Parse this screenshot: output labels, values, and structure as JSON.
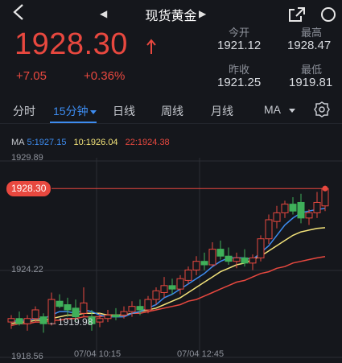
{
  "nav": {
    "title": "现货黄金",
    "back_icon": "back-arrow-icon",
    "share_icon": "share-icon",
    "search_icon": "search-icon"
  },
  "quote": {
    "price": "1928.30",
    "change": "+7.05",
    "change_pct": "+0.36%",
    "color_up": "#e8483f"
  },
  "stats": {
    "open_label": "今开",
    "open": "1921.12",
    "high_label": "最高",
    "high": "1928.47",
    "prev_close_label": "昨收",
    "prev_close": "1921.25",
    "low_label": "最低",
    "low": "1919.81"
  },
  "tabs": {
    "items": [
      "分时",
      "15分钟",
      "日线",
      "周线",
      "月线",
      "MA"
    ],
    "active": "15分钟",
    "active_color": "#3d8cf0"
  },
  "ma_legend": {
    "title": "MA",
    "ma5": "5:1927.15",
    "ma10": "10:1926.04",
    "ma22": "22:1924.38",
    "colors": {
      "ma5": "#3d8cf0",
      "ma10": "#f3e37a",
      "ma22": "#e8483f"
    }
  },
  "chart_axis": {
    "y_top": "1929.89",
    "y_mid": "1924.22",
    "y_bottom": "1918.56",
    "x_label_1": "07/04 10:15",
    "x_label_2": "07/04 12:45",
    "current_tag": "1928.30",
    "low_marker": "←1919.98"
  },
  "chart_data": {
    "type": "candlestick",
    "ylim": [
      1918.56,
      1929.89
    ],
    "candles": [
      {
        "o": 1920.6,
        "h": 1921.0,
        "l": 1920.2,
        "c": 1920.8
      },
      {
        "o": 1920.8,
        "h": 1921.2,
        "l": 1920.4,
        "c": 1920.5
      },
      {
        "o": 1920.5,
        "h": 1921.0,
        "l": 1920.1,
        "c": 1920.8
      },
      {
        "o": 1920.8,
        "h": 1921.5,
        "l": 1920.6,
        "c": 1921.3
      },
      {
        "o": 1920.9,
        "h": 1921.1,
        "l": 1919.98,
        "c": 1920.5
      },
      {
        "o": 1920.5,
        "h": 1922.3,
        "l": 1920.4,
        "c": 1921.9
      },
      {
        "o": 1921.8,
        "h": 1922.2,
        "l": 1921.4,
        "c": 1921.5
      },
      {
        "o": 1921.6,
        "h": 1922.0,
        "l": 1920.9,
        "c": 1921.3
      },
      {
        "o": 1921.4,
        "h": 1921.9,
        "l": 1920.6,
        "c": 1920.9
      },
      {
        "o": 1921.1,
        "h": 1922.6,
        "l": 1920.9,
        "c": 1921.7
      },
      {
        "o": 1920.9,
        "h": 1921.3,
        "l": 1920.1,
        "c": 1920.5
      },
      {
        "o": 1920.6,
        "h": 1921.1,
        "l": 1920.3,
        "c": 1920.8
      },
      {
        "o": 1920.8,
        "h": 1921.3,
        "l": 1920.6,
        "c": 1921.0
      },
      {
        "o": 1921.0,
        "h": 1921.4,
        "l": 1920.7,
        "c": 1920.9
      },
      {
        "o": 1921.0,
        "h": 1921.5,
        "l": 1920.8,
        "c": 1921.2
      },
      {
        "o": 1921.2,
        "h": 1921.8,
        "l": 1920.9,
        "c": 1921.5
      },
      {
        "o": 1921.5,
        "h": 1921.9,
        "l": 1921.0,
        "c": 1921.3
      },
      {
        "o": 1921.3,
        "h": 1922.1,
        "l": 1921.1,
        "c": 1921.9
      },
      {
        "o": 1921.9,
        "h": 1922.6,
        "l": 1921.6,
        "c": 1922.4
      },
      {
        "o": 1922.3,
        "h": 1923.2,
        "l": 1922.0,
        "c": 1922.7
      },
      {
        "o": 1922.7,
        "h": 1923.1,
        "l": 1922.2,
        "c": 1922.5
      },
      {
        "o": 1922.5,
        "h": 1923.3,
        "l": 1922.2,
        "c": 1923.1
      },
      {
        "o": 1923.0,
        "h": 1923.8,
        "l": 1922.8,
        "c": 1923.6
      },
      {
        "o": 1923.6,
        "h": 1924.4,
        "l": 1923.3,
        "c": 1924.1
      },
      {
        "o": 1924.1,
        "h": 1924.6,
        "l": 1923.6,
        "c": 1923.9
      },
      {
        "o": 1923.9,
        "h": 1925.2,
        "l": 1923.8,
        "c": 1924.8
      },
      {
        "o": 1924.8,
        "h": 1925.3,
        "l": 1924.2,
        "c": 1924.4
      },
      {
        "o": 1924.4,
        "h": 1924.9,
        "l": 1923.9,
        "c": 1924.1
      },
      {
        "o": 1924.1,
        "h": 1924.6,
        "l": 1923.7,
        "c": 1924.3
      },
      {
        "o": 1924.3,
        "h": 1924.8,
        "l": 1923.8,
        "c": 1924.0
      },
      {
        "o": 1924.0,
        "h": 1924.5,
        "l": 1923.6,
        "c": 1924.3
      },
      {
        "o": 1924.3,
        "h": 1925.6,
        "l": 1924.1,
        "c": 1925.4
      },
      {
        "o": 1925.4,
        "h": 1926.8,
        "l": 1925.1,
        "c": 1926.5
      },
      {
        "o": 1926.4,
        "h": 1927.3,
        "l": 1926.0,
        "c": 1926.9
      },
      {
        "o": 1926.9,
        "h": 1927.6,
        "l": 1926.6,
        "c": 1927.4
      },
      {
        "o": 1927.4,
        "h": 1927.8,
        "l": 1926.8,
        "c": 1927.0
      },
      {
        "o": 1927.5,
        "h": 1928.0,
        "l": 1926.3,
        "c": 1926.6
      },
      {
        "o": 1926.6,
        "h": 1927.1,
        "l": 1926.2,
        "c": 1926.9
      },
      {
        "o": 1926.9,
        "h": 1928.1,
        "l": 1926.6,
        "c": 1927.5
      },
      {
        "o": 1927.3,
        "h": 1928.47,
        "l": 1927.0,
        "c": 1928.3
      }
    ],
    "ma5": [
      1920.6,
      1920.7,
      1920.7,
      1920.8,
      1920.8,
      1921.0,
      1921.2,
      1921.2,
      1921.1,
      1921.3,
      1921.2,
      1921.0,
      1920.9,
      1920.9,
      1920.9,
      1921.1,
      1921.2,
      1921.4,
      1921.6,
      1922.0,
      1922.2,
      1922.5,
      1922.8,
      1923.1,
      1923.4,
      1923.8,
      1924.1,
      1924.3,
      1924.3,
      1924.3,
      1924.2,
      1924.6,
      1925.0,
      1925.6,
      1926.2,
      1926.6,
      1926.9,
      1927.0,
      1927.1,
      1927.15
    ],
    "ma10": [
      1920.5,
      1920.6,
      1920.6,
      1920.7,
      1920.7,
      1920.8,
      1920.9,
      1921.0,
      1921.0,
      1921.1,
      1921.1,
      1921.1,
      1921.0,
      1921.0,
      1921.0,
      1921.1,
      1921.2,
      1921.3,
      1921.4,
      1921.6,
      1921.8,
      1922.0,
      1922.3,
      1922.6,
      1922.9,
      1923.2,
      1923.5,
      1923.7,
      1923.9,
      1924.0,
      1924.2,
      1924.4,
      1924.7,
      1925.0,
      1925.3,
      1925.6,
      1925.8,
      1925.9,
      1926.0,
      1926.04
    ],
    "ma22": [
      1920.4,
      1920.5,
      1920.5,
      1920.6,
      1920.6,
      1920.7,
      1920.7,
      1920.8,
      1920.8,
      1920.9,
      1920.9,
      1920.9,
      1921.0,
      1921.0,
      1921.0,
      1921.1,
      1921.1,
      1921.2,
      1921.3,
      1921.4,
      1921.5,
      1921.6,
      1921.8,
      1921.9,
      1922.1,
      1922.3,
      1922.5,
      1922.7,
      1922.9,
      1923.0,
      1923.2,
      1923.4,
      1923.5,
      1923.7,
      1923.8,
      1924.0,
      1924.1,
      1924.2,
      1924.3,
      1924.38
    ],
    "up_color": "#e8483f",
    "down_color": "#3fb05a"
  }
}
